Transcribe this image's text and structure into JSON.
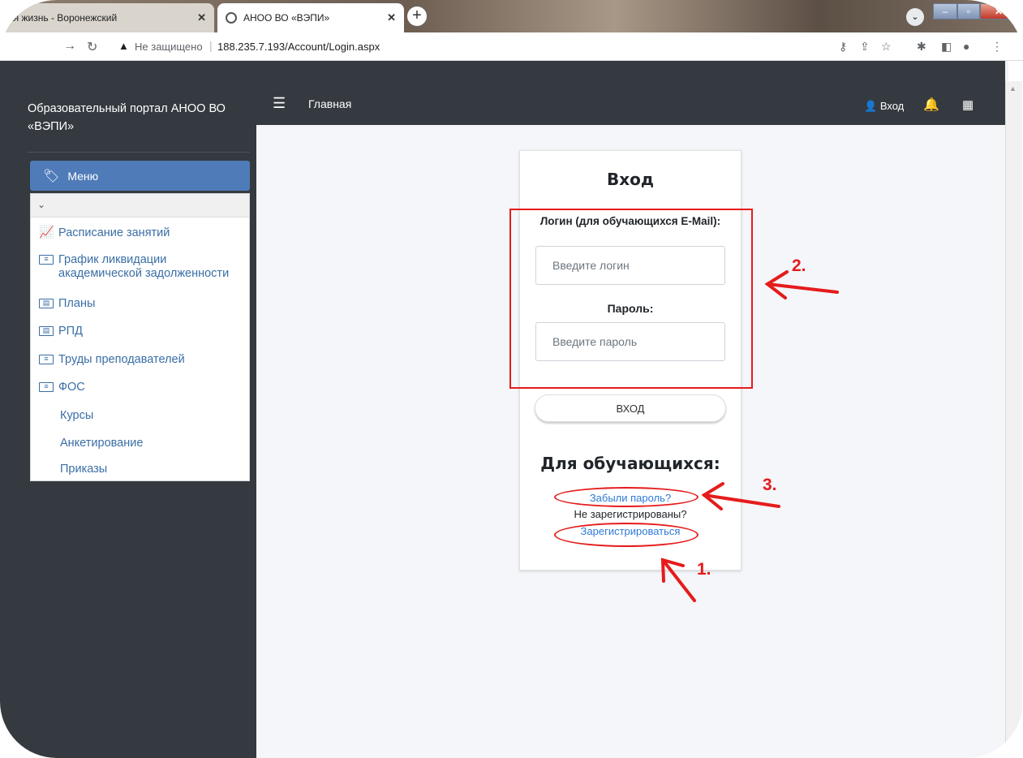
{
  "browser": {
    "tabs": [
      {
        "label": "ая жизнь - Воронежский"
      },
      {
        "label": "АНОО ВО «ВЭПИ»"
      }
    ],
    "new_tab": "+",
    "address": {
      "security_label": "Не защищено",
      "url": "188.235.7.193/Account/Login.aspx"
    }
  },
  "sidebar": {
    "brand": "Образовательный портал АНОО ВО «ВЭПИ»",
    "menu_label": "Меню",
    "items": [
      {
        "label": "Расписание занятий"
      },
      {
        "label": "График ликвидации академической задолженности"
      },
      {
        "label": "Планы"
      },
      {
        "label": "РПД"
      },
      {
        "label": "Труды преподавателей"
      },
      {
        "label": "ФОС"
      },
      {
        "label": "Курсы"
      },
      {
        "label": "Анкетирование"
      },
      {
        "label": "Приказы"
      }
    ]
  },
  "topnav": {
    "home": "Главная",
    "login": "Вход"
  },
  "login_card": {
    "title": "Вход",
    "login_label": "Логин (для обучающихся E-Mail):",
    "login_placeholder": "Введите логин",
    "password_label": "Пароль:",
    "password_placeholder": "Введите пароль",
    "submit_label": "вход",
    "students_title": "Для обучающихся:",
    "forgot_link": "Забыли пароль?",
    "not_registered": "Не зарегистрированы?",
    "register_link": "Зарегистрироваться"
  },
  "annotations": {
    "numbers": [
      "1.",
      "2.",
      "3."
    ],
    "color": "#e61b1b"
  },
  "colors": {
    "sidebar_bg": "#343a40",
    "menu_accent": "#4f7cb8",
    "link": "#2f7ad6",
    "content_bg": "#f4f6f9"
  }
}
